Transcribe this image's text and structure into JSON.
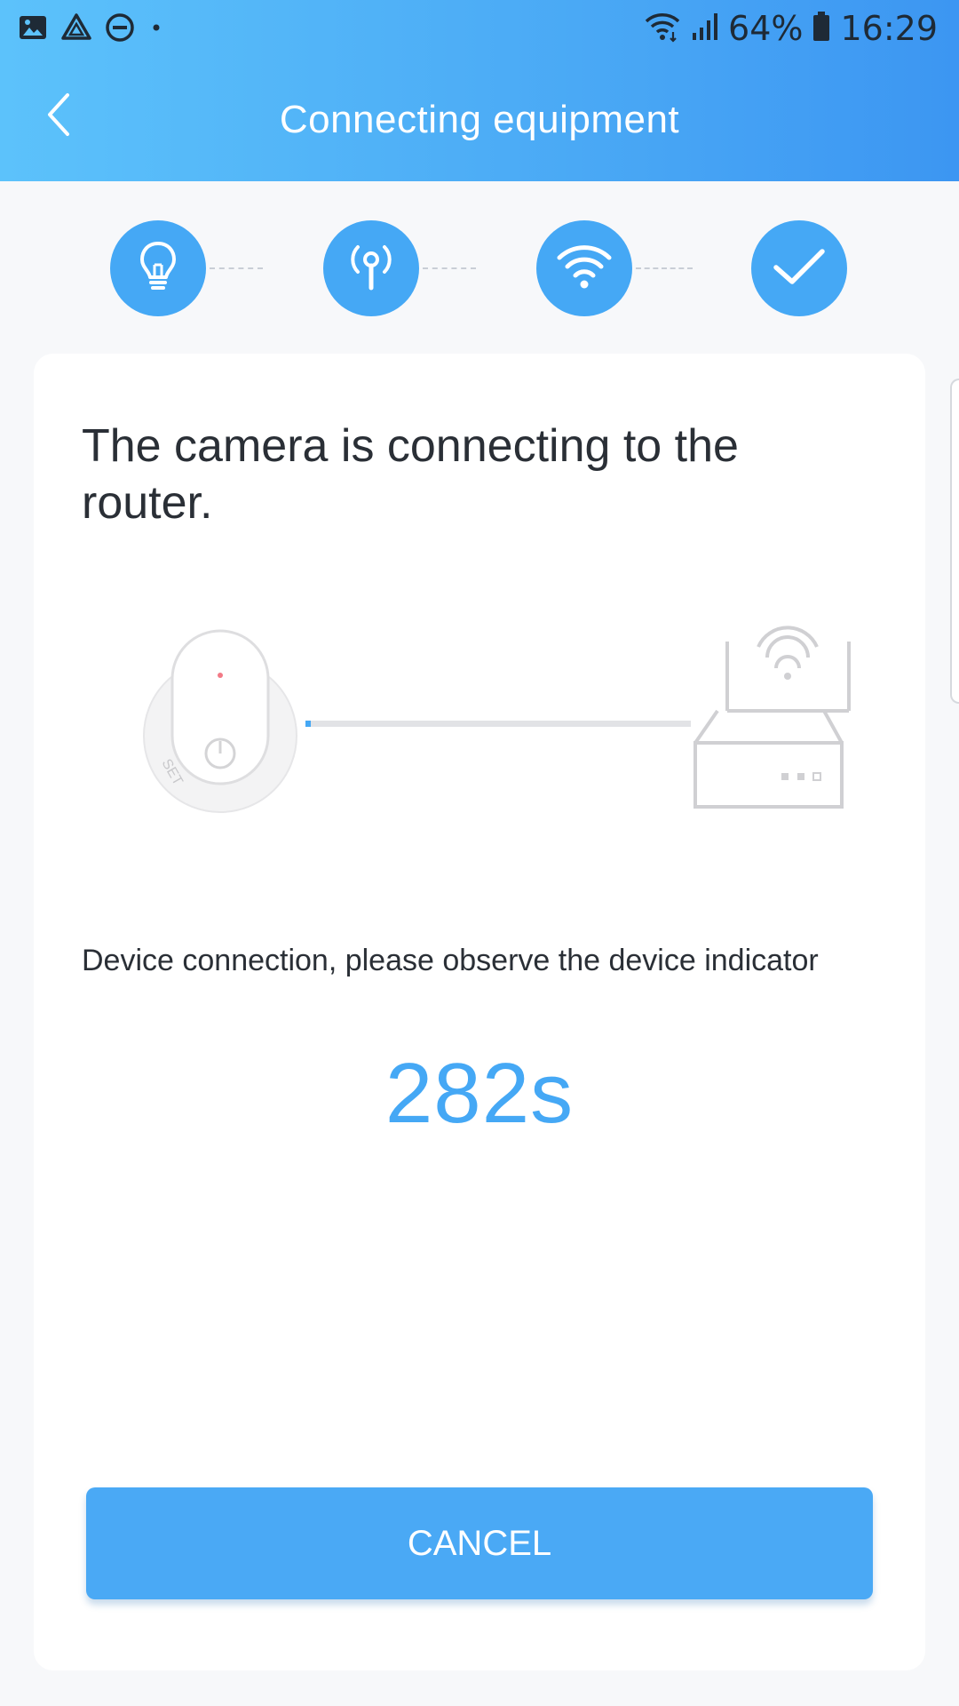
{
  "status_bar": {
    "battery_percent": "64%",
    "time": "16:29",
    "left_icons": [
      "gallery-icon",
      "drive-icon",
      "do-not-disturb-icon",
      "dot-icon"
    ],
    "right_icons": [
      "wifi-icon",
      "signal-icon",
      "battery-icon"
    ]
  },
  "header": {
    "title": "Connecting equipment",
    "back_icon": "chevron-left-icon"
  },
  "steps": [
    {
      "icon": "bulb-icon",
      "state": "done"
    },
    {
      "icon": "antenna-icon",
      "state": "done"
    },
    {
      "icon": "wifi-icon",
      "state": "done"
    },
    {
      "icon": "check-icon",
      "state": "done"
    }
  ],
  "card": {
    "heading": "The camera is connecting to the router.",
    "illustration": {
      "camera_label": "SET",
      "progress": 0.01
    },
    "instruction": "Device connection, please observe the device indicator",
    "countdown": "282s",
    "cancel_label": "CANCEL"
  },
  "colors": {
    "accent": "#45a8f5",
    "header_start": "#5cc2fb",
    "header_end": "#3c96f2",
    "background": "#f7f8fa",
    "text": "#2a2f36"
  }
}
